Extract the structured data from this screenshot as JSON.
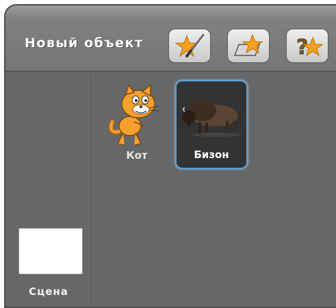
{
  "sprites_panel": {
    "title": "Новый объект",
    "toolbar": [
      {
        "name": "paint-new-sprite",
        "icon": "star-paintbrush-icon"
      },
      {
        "name": "choose-sprite-from-file",
        "icon": "star-folder-icon"
      },
      {
        "name": "random-sprite",
        "icon": "star-question-icon"
      }
    ],
    "stage": {
      "label": "Сцена"
    },
    "sprites": [
      {
        "label": "Кот",
        "icon": "cat-sprite-icon",
        "selected": false
      },
      {
        "label": "Бизон",
        "icon": "bison-sprite-icon",
        "selected": true
      }
    ]
  },
  "colors": {
    "panel_bg": "#666768",
    "selection_border": "#5f9fd0",
    "star": "#f4a020"
  }
}
